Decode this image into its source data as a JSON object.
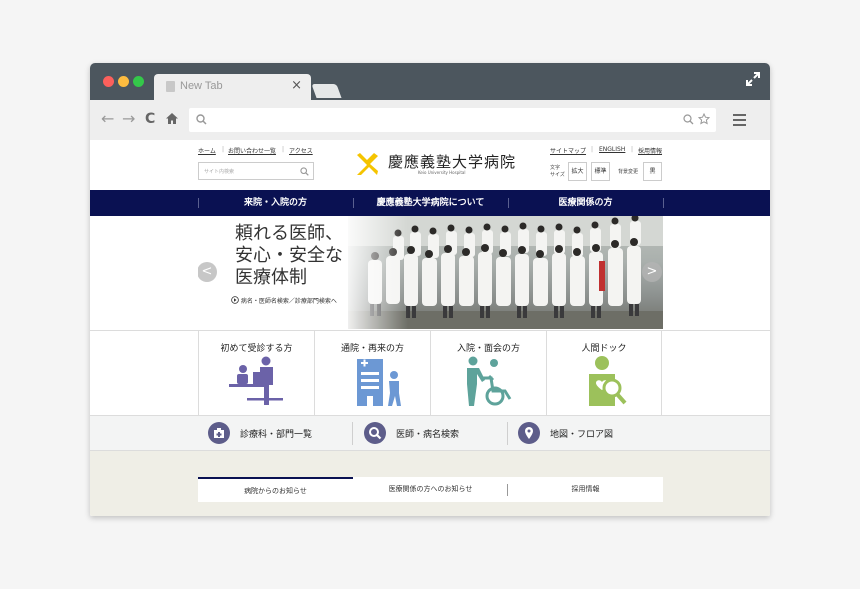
{
  "browser": {
    "tab_title": "New Tab",
    "tab_close": "×",
    "back_glyph": "←",
    "forward_glyph": "→",
    "reload_glyph": "C"
  },
  "site": {
    "top_links": [
      "ホーム",
      "お問い合わせ一覧",
      "アクセス"
    ],
    "search_placeholder": "サイト内検索",
    "logo_name": "慶應義塾大学病院",
    "logo_sub": "Keio University Hospital",
    "util_links": [
      "サイトマップ",
      "ENGLISH",
      "採用情報"
    ],
    "text_size_label_1": "文字",
    "text_size_label_2": "サイズ",
    "size_large": "拡大",
    "size_standard": "標準",
    "bg_label": "背景変更",
    "bg_black": "黒",
    "brand_color": "#0a1152",
    "logo_color": "#f5c400"
  },
  "global_nav": [
    "来院・入院の方",
    "慶應義塾大学病院について",
    "医療関係の方"
  ],
  "hero": {
    "line1": "頼れる医師、",
    "line2": "安心・安全な",
    "line3": "医療体制",
    "link": "病名・医師名検索／診療部門検索へ",
    "prev": "<",
    "next": ">"
  },
  "categories": [
    {
      "label": "初めて受診する方",
      "icon": "reception-icon",
      "color": "#6b62a8"
    },
    {
      "label": "通院・再来の方",
      "icon": "hospital-visit-icon",
      "color": "#6c98d4"
    },
    {
      "label": "入院・面会の方",
      "icon": "wheelchair-icon",
      "color": "#5ea39b"
    },
    {
      "label": "人間ドック",
      "icon": "health-check-icon",
      "color": "#9cc15b"
    }
  ],
  "search_row": [
    {
      "label": "診療科・部門一覧",
      "icon": "medical-bag-icon"
    },
    {
      "label": "医師・病名検索",
      "icon": "search-icon"
    },
    {
      "label": "地図・フロア図",
      "icon": "map-pin-icon"
    }
  ],
  "news_tabs": [
    "病院からのお知らせ",
    "医療関係の方へのお知らせ",
    "採用情報"
  ]
}
